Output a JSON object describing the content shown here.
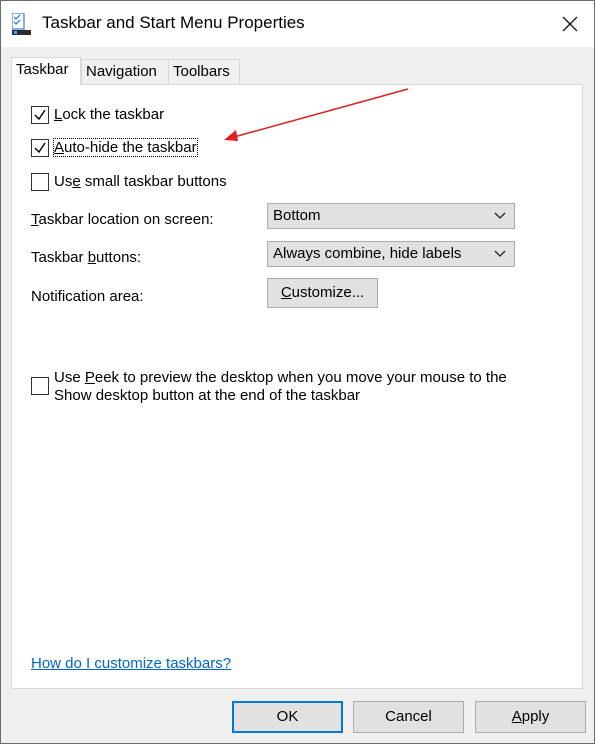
{
  "window": {
    "title": "Taskbar and Start Menu Properties"
  },
  "tabs": [
    {
      "label": "Taskbar",
      "active": true
    },
    {
      "label": "Navigation",
      "active": false
    },
    {
      "label": "Toolbars",
      "active": false
    }
  ],
  "taskbar": {
    "lock": {
      "pre": "",
      "u": "L",
      "post": "ock the taskbar",
      "checked": true
    },
    "autohide": {
      "pre": "",
      "u": "A",
      "post": "uto-hide the taskbar",
      "checked": true
    },
    "small": {
      "pre": "Us",
      "u": "e",
      "post": " small taskbar buttons",
      "checked": false
    },
    "location": {
      "u": "T",
      "post": "askbar location on screen:",
      "value": "Bottom"
    },
    "buttons": {
      "pre": "Taskbar ",
      "u": "b",
      "post": "uttons:",
      "value": "Always combine, hide labels"
    },
    "notification": {
      "label": "Notification area:",
      "button_u": "C",
      "button_post": "ustomize..."
    },
    "peek": {
      "line1_pre": "Use ",
      "line1_u": "P",
      "line1_post": "eek to preview the desktop when you move your mouse to the",
      "line2": "Show desktop button at the end of the taskbar",
      "checked": false
    },
    "help_link": "How do I customize taskbars?"
  },
  "footer": {
    "ok": "OK",
    "cancel": "Cancel",
    "apply_u": "A",
    "apply_post": "pply"
  },
  "colors": {
    "accent": "#0078d7",
    "link": "#0066cc",
    "annotation_arrow": "#e02020"
  }
}
